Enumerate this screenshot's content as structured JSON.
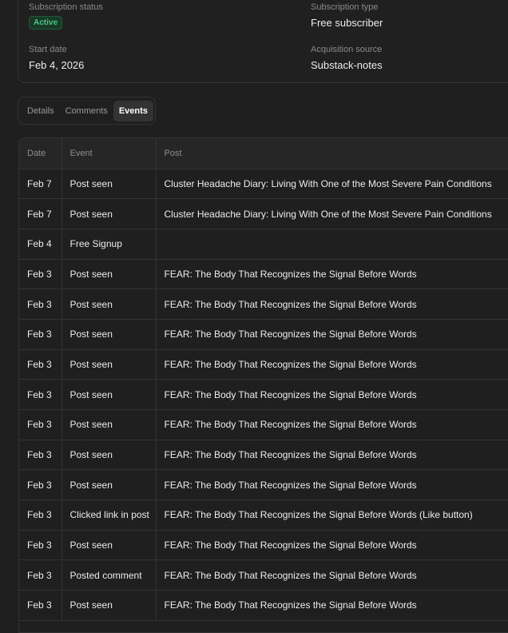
{
  "subscriber": {
    "status_label": "Subscription status",
    "status_value": "Active",
    "type_label": "Subscription type",
    "type_value": "Free subscriber",
    "start_label": "Start date",
    "start_value": "Feb 4, 2026",
    "source_label": "Acquisition source",
    "source_value": "Substack-notes"
  },
  "tabs": [
    {
      "label": "Details",
      "active": false
    },
    {
      "label": "Comments",
      "active": false
    },
    {
      "label": "Events",
      "active": true
    }
  ],
  "table": {
    "headers": [
      "Date",
      "Event",
      "Post"
    ],
    "rows": [
      {
        "date": "Feb 7",
        "event": "Post seen",
        "post": "Cluster Headache Diary: Living With One of the Most Severe Pain Conditions"
      },
      {
        "date": "Feb 7",
        "event": "Post seen",
        "post": "Cluster Headache Diary: Living With One of the Most Severe Pain Conditions"
      },
      {
        "date": "Feb 4",
        "event": "Free Signup",
        "post": ""
      },
      {
        "date": "Feb 3",
        "event": "Post seen",
        "post": "FEAR: The Body That Recognizes the Signal Before Words"
      },
      {
        "date": "Feb 3",
        "event": "Post seen",
        "post": "FEAR: The Body That Recognizes the Signal Before Words"
      },
      {
        "date": "Feb 3",
        "event": "Post seen",
        "post": "FEAR: The Body That Recognizes the Signal Before Words"
      },
      {
        "date": "Feb 3",
        "event": "Post seen",
        "post": "FEAR: The Body That Recognizes the Signal Before Words"
      },
      {
        "date": "Feb 3",
        "event": "Post seen",
        "post": "FEAR: The Body That Recognizes the Signal Before Words"
      },
      {
        "date": "Feb 3",
        "event": "Post seen",
        "post": "FEAR: The Body That Recognizes the Signal Before Words"
      },
      {
        "date": "Feb 3",
        "event": "Post seen",
        "post": "FEAR: The Body That Recognizes the Signal Before Words"
      },
      {
        "date": "Feb 3",
        "event": "Post seen",
        "post": "FEAR: The Body That Recognizes the Signal Before Words"
      },
      {
        "date": "Feb 3",
        "event": "Clicked link in post",
        "post": "FEAR: The Body That Recognizes the Signal Before Words (Like button)"
      },
      {
        "date": "Feb 3",
        "event": "Post seen",
        "post": "FEAR: The Body That Recognizes the Signal Before Words"
      },
      {
        "date": "Feb 3",
        "event": "Posted comment",
        "post": "FEAR: The Body That Recognizes the Signal Before Words"
      },
      {
        "date": "Feb 3",
        "event": "Post seen",
        "post": "FEAR: The Body That Recognizes the Signal Before Words"
      }
    ]
  }
}
